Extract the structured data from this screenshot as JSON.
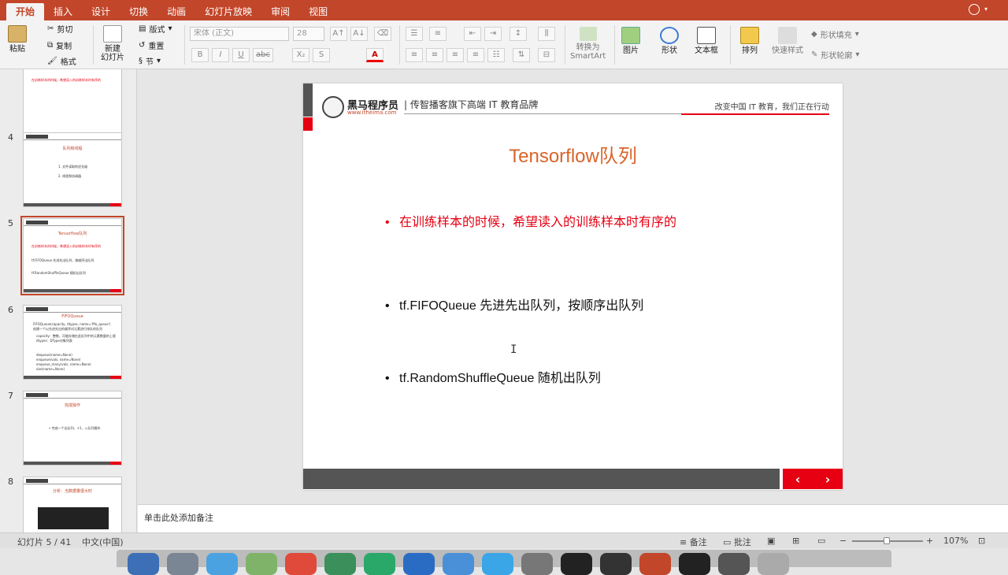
{
  "ribbon_tabs": [
    "开始",
    "插入",
    "设计",
    "切换",
    "动画",
    "幻灯片放映",
    "审阅",
    "视图"
  ],
  "clipboard": {
    "paste": "粘贴",
    "cut": "剪切",
    "copy": "复制",
    "format": "格式"
  },
  "slides_group": {
    "new_slide": "新建\n幻灯片",
    "layout": "版式",
    "reset": "重置",
    "section": "节"
  },
  "font": {
    "family": "宋体 (正文)",
    "size": "28",
    "bold": "B",
    "italic": "I",
    "underline": "U",
    "strike": "abc",
    "subscript": "X₂",
    "font_color": "A"
  },
  "drawing": {
    "smartart": "转换为\nSmartArt",
    "picture": "图片",
    "shape": "形状",
    "textbox": "文本框",
    "arrange": "排列",
    "quick_styles": "快速样式",
    "shape_fill": "形状填充",
    "shape_outline": "形状轮廓"
  },
  "thumbnails": [
    {
      "num": "",
      "title": "",
      "lines": [
        "在训练样本的时候，希望读入的训练样本时有序的"
      ]
    },
    {
      "num": "4",
      "title": "队列和线程",
      "lines": [
        "1. 文件读取的优先级",
        "2. 线程和协调器"
      ]
    },
    {
      "num": "5",
      "title": "Tensorflow队列",
      "lines": [
        "在训练样本的时候，希望读入的训练样本时有序的",
        "tf.FIFOQueue 先进先出队列，按顺序出队列",
        "tf.RandomShuffleQueue 随机出队列"
      ]
    },
    {
      "num": "6",
      "title": "FIFOQueue",
      "lines": [
        "FIFOQueue(capacity, dtypes, name='fifo_queue')",
        "创建一个以先进先出的顺序对元素进行排队的队列",
        "capacity：整数，可能存储在此队列中的元素数量的上限",
        "dtypes：DType对象列表",
        "dequeue(name=None)",
        "enqueue(vals, name=None)",
        "enqueue_many(vals, name=None)",
        "size(name=None)"
      ]
    },
    {
      "num": "7",
      "title": "完成操作",
      "lines": [
        "• 完成一个出队列、+1、入队列操作"
      ]
    },
    {
      "num": "8",
      "title": "分析：当数据量很大时",
      "lines": [
        ""
      ]
    }
  ],
  "slide": {
    "brand": "黑马程序员",
    "brand_url": "www.itheima.com",
    "tagline": "| 传智播客旗下高端 IT 教育品牌",
    "slogan": "改变中国 IT 教育，我们正在行动",
    "title": "Tensorflow队列",
    "bullet1": "在训练样本的时候，希望读入的训练样本时有序的",
    "bullet2": "tf.FIFOQueue 先进先出队列，按顺序出队列",
    "bullet3": "tf.RandomShuffleQueue 随机出队列",
    "nav_prev": "‹",
    "nav_next": "›"
  },
  "notes_placeholder": "单击此处添加备注",
  "status": {
    "slide_counter": "幻灯片 5 / 41",
    "language": "中文(中国)",
    "notes": "备注",
    "comments": "批注",
    "zoom": "107%"
  },
  "accent": "#c2462a"
}
